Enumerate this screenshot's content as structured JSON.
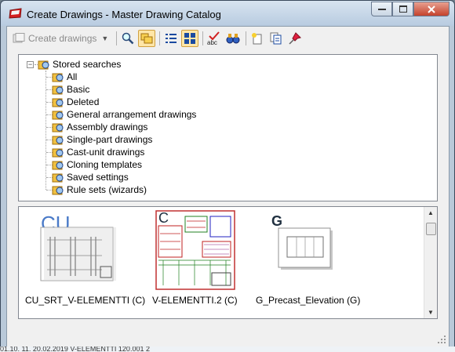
{
  "window": {
    "title": "Create Drawings - Master Drawing Catalog"
  },
  "toolbar": {
    "create_label": "Create drawings",
    "icons": [
      "create-drawings-icon",
      "search-icon",
      "filter-icon",
      "list-view-icon",
      "thumbnail-view-icon",
      "spell-check-icon",
      "binoculars-icon",
      "new-sheet-icon",
      "copy-sheet-icon",
      "pin-icon"
    ]
  },
  "tree": {
    "root": "Stored searches",
    "items": [
      {
        "label": "All"
      },
      {
        "label": "Basic"
      },
      {
        "label": "Deleted"
      },
      {
        "label": "General arrangement drawings"
      },
      {
        "label": "Assembly drawings"
      },
      {
        "label": "Single-part drawings"
      },
      {
        "label": "Cast-unit drawings"
      },
      {
        "label": "Cloning templates"
      },
      {
        "label": "Saved settings"
      },
      {
        "label": "Rule sets (wizards)"
      }
    ]
  },
  "thumbnails": [
    {
      "label": "CU_SRT_V-ELEMENTTI (C)",
      "badge": "CU"
    },
    {
      "label": "V-ELEMENTTI.2 (C)",
      "badge": "C"
    },
    {
      "label": "G_Precast_Elevation (G)",
      "badge": "G"
    }
  ],
  "background_row": "01.10.   11.    20.02.2019    V-ELEMENTTI                        120.001                 2"
}
